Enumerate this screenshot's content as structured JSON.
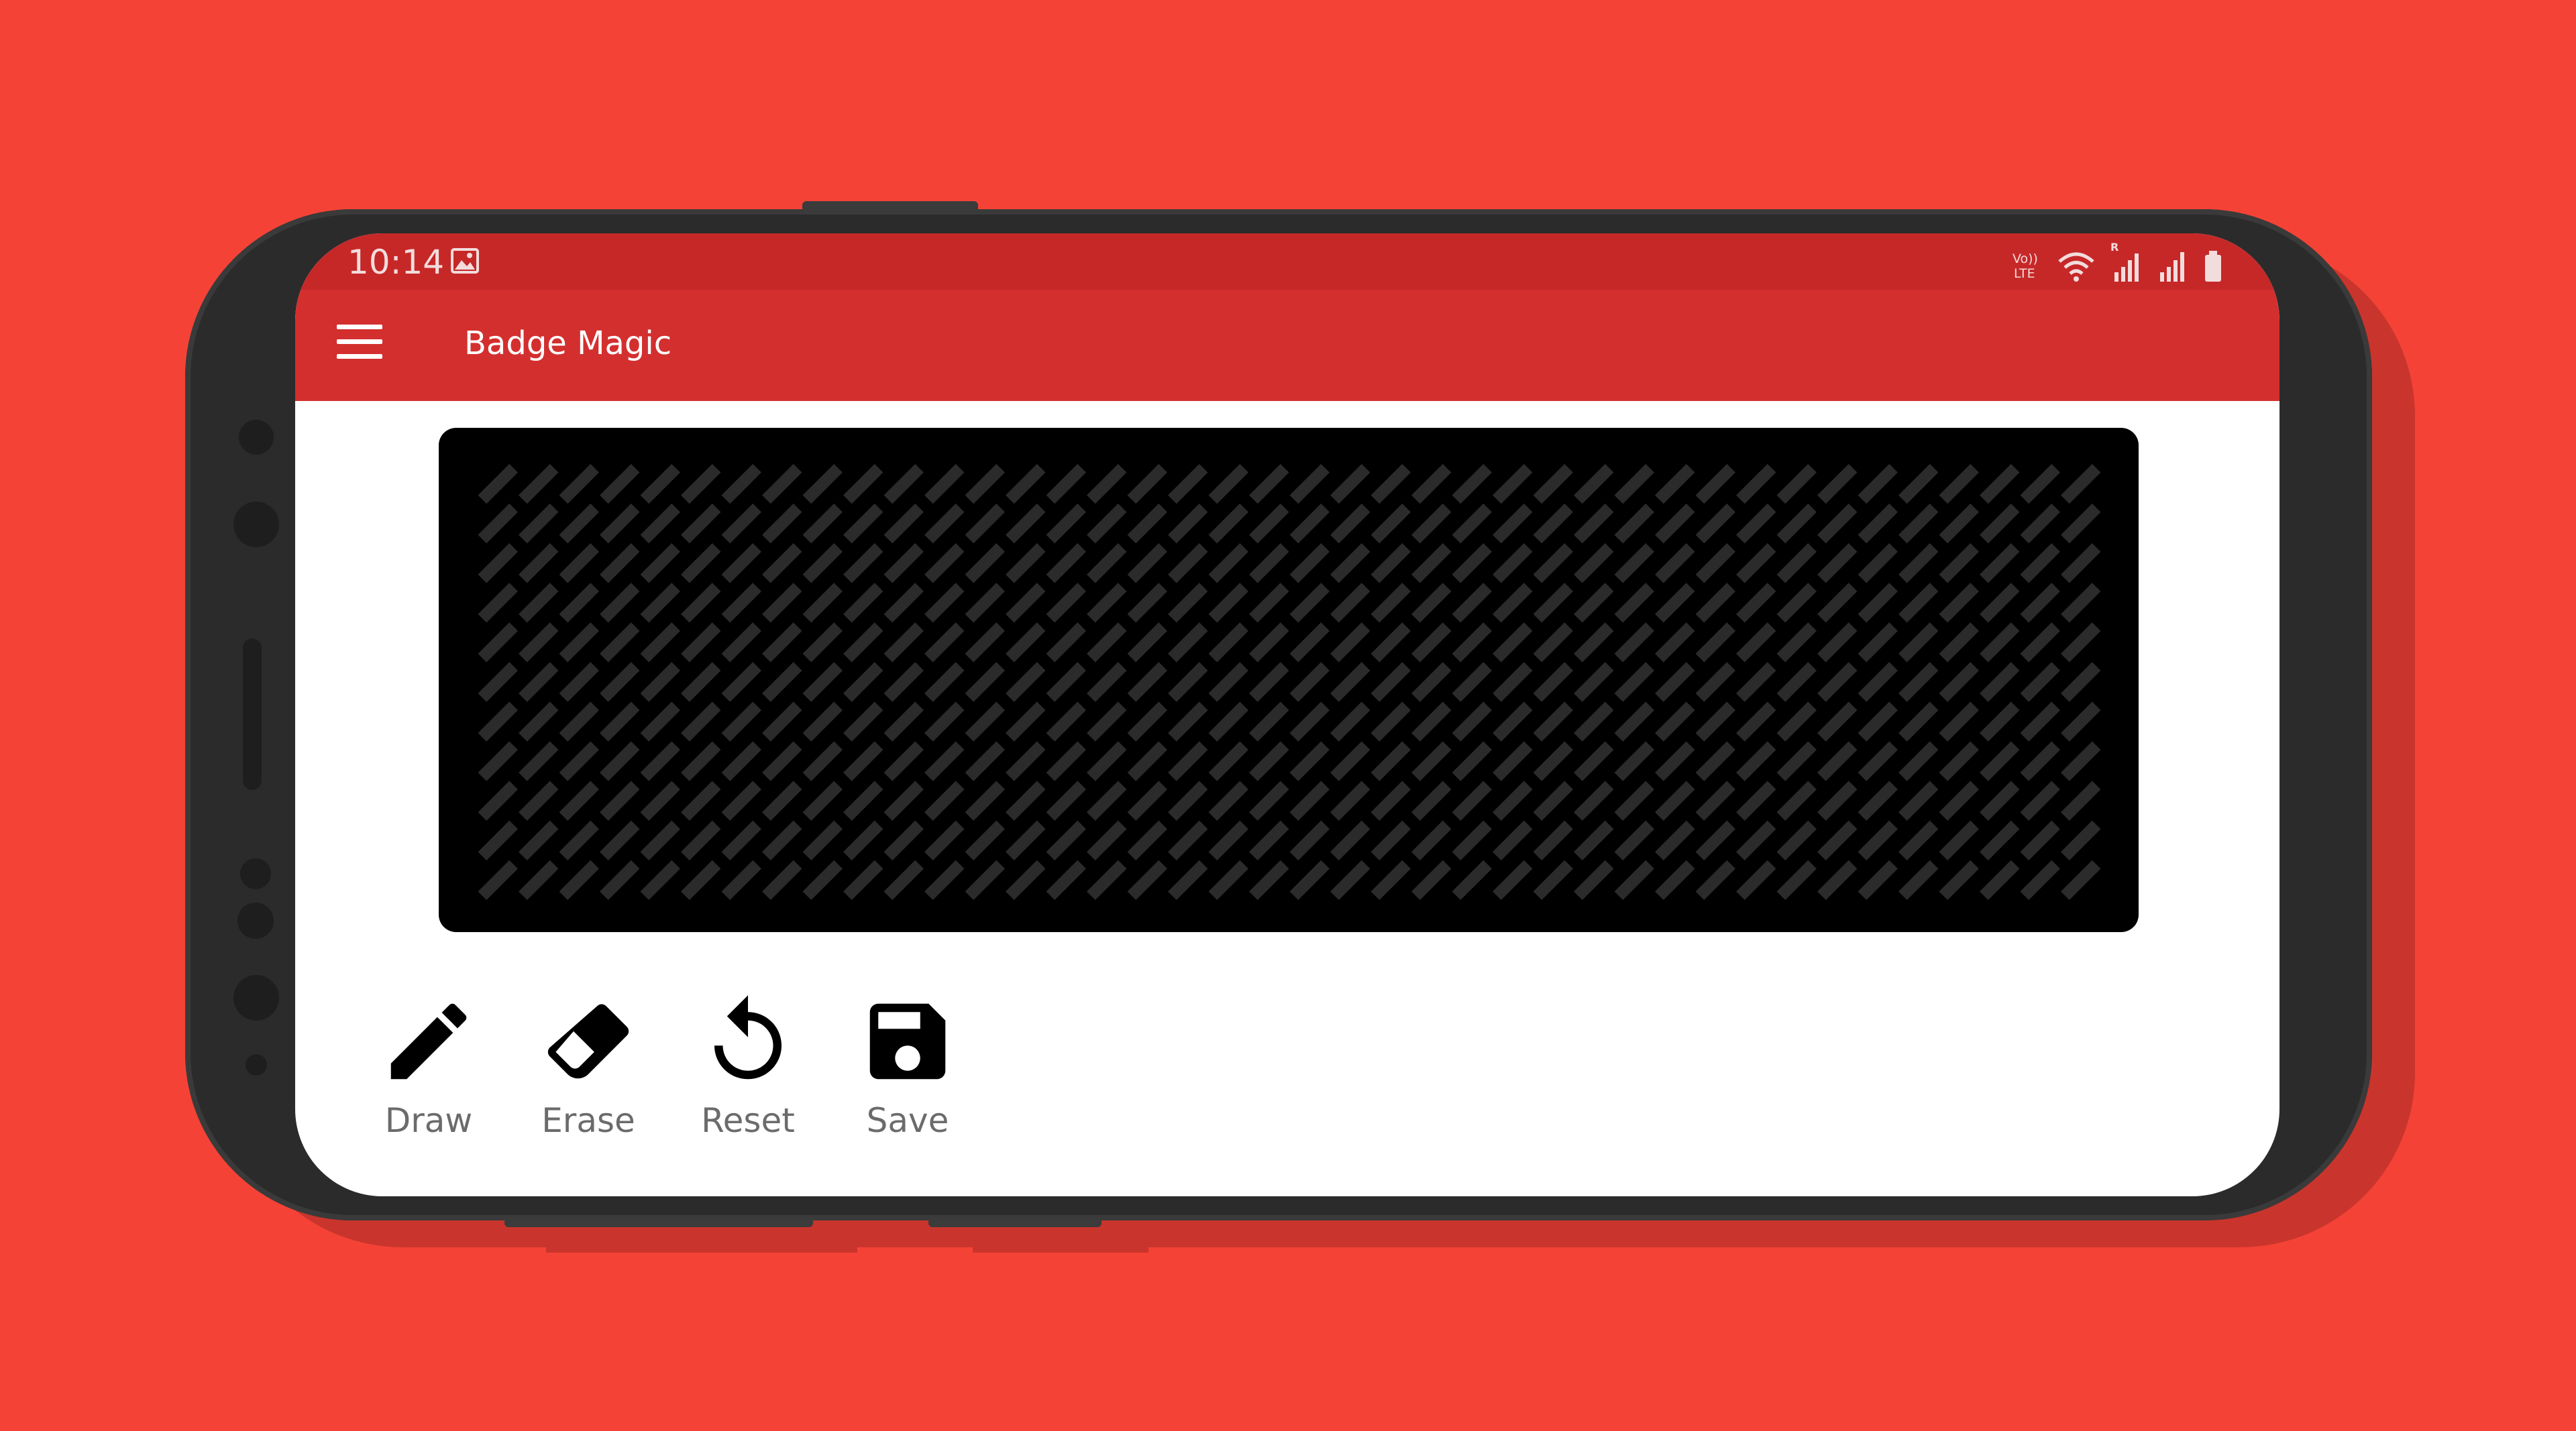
{
  "status_bar": {
    "time": "10:14",
    "icons": [
      "gallery-icon",
      "volte-icon",
      "wifi-icon",
      "roaming-signal-icon",
      "signal-icon",
      "battery-icon"
    ],
    "volte_label_top": "Vo))",
    "volte_label_bottom": "LTE",
    "roaming_label": "R"
  },
  "toolbar": {
    "title": "Badge Magic",
    "menu_icon": "hamburger-menu-icon"
  },
  "badge": {
    "rows": 11,
    "columns": 40,
    "led_color": "#2b2b2b",
    "background": "#000000"
  },
  "tools": [
    {
      "name": "draw",
      "label": "Draw",
      "icon": "pencil-icon"
    },
    {
      "name": "erase",
      "label": "Erase",
      "icon": "eraser-icon"
    },
    {
      "name": "reset",
      "label": "Reset",
      "icon": "undo-icon"
    },
    {
      "name": "save",
      "label": "Save",
      "icon": "floppy-disk-icon"
    }
  ],
  "colors": {
    "background": "#f44336",
    "status_bar": "#c62828",
    "toolbar": "#d32f2f",
    "phone_body": "#2b2b2b"
  }
}
